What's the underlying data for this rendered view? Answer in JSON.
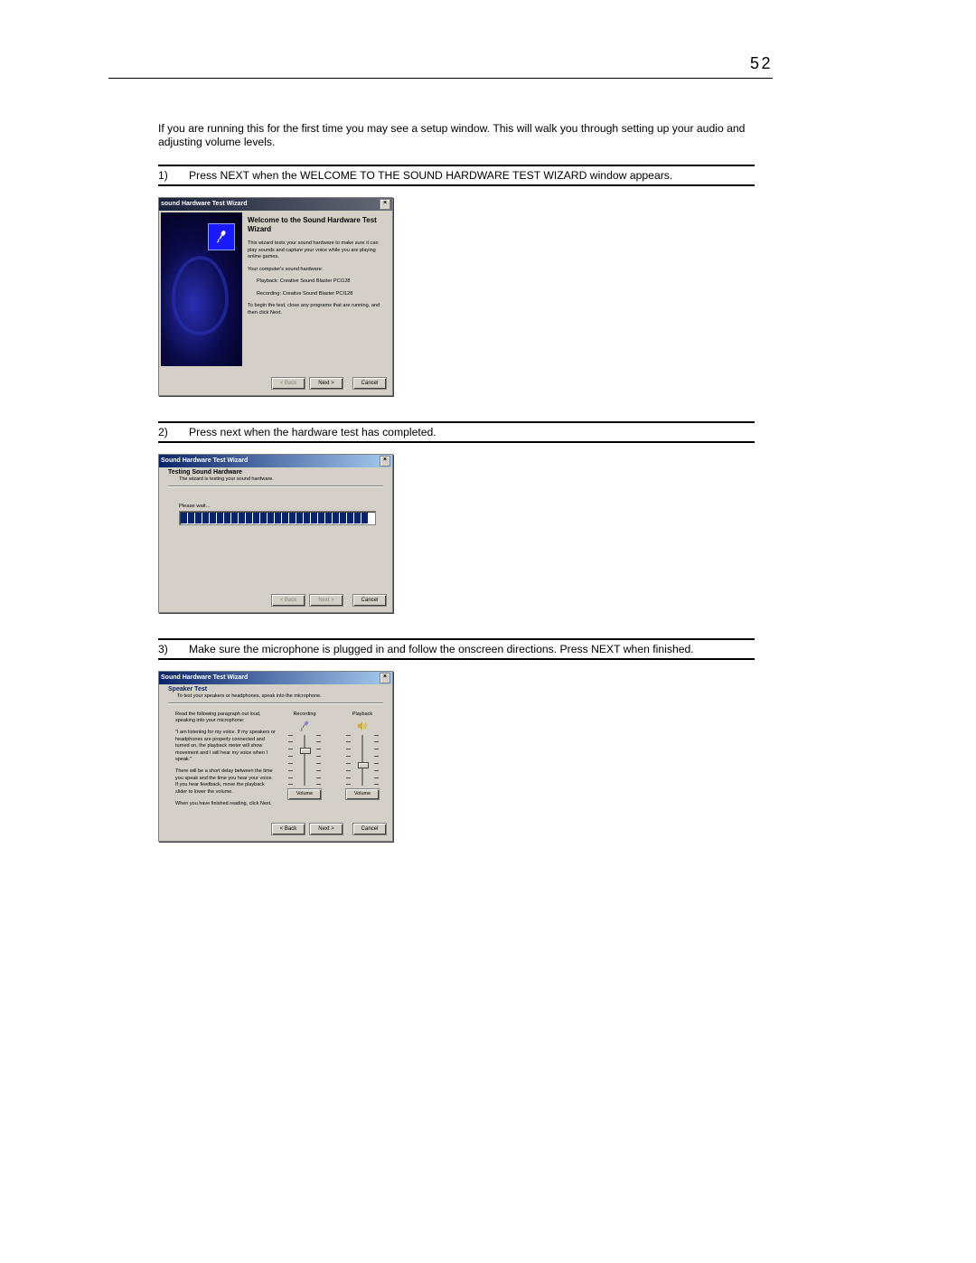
{
  "page_number": "52",
  "intro": "If you are running this for the first time you may see a setup window. This will walk you through setting up your audio and adjusting volume levels.",
  "steps": [
    {
      "num": "1)",
      "text": "Press NEXT when the WELCOME TO THE SOUND HARDWARE TEST WIZARD window appears."
    },
    {
      "num": "2)",
      "text": "Press next when the hardware test has completed."
    },
    {
      "num": "3)",
      "text": "Make sure the microphone is plugged in and follow the onscreen directions. Press NEXT when finished."
    }
  ],
  "dlg_shared": {
    "back": "< Back",
    "next": "Next >",
    "cancel": "Cancel",
    "close": "×"
  },
  "dlg1": {
    "title": "sound Hardware Test Wizard",
    "heading": "Welcome to the Sound Hardware Test Wizard",
    "p1": "This wizard tests your sound hardware to make sure it can play sounds and capture your voice while you are playing online games.",
    "p2": "Your computer's sound hardware:",
    "playback": "Playback: Creative Sound Blaster PCI128",
    "recording": "Recording: Creative Sound Blaster PCI128",
    "p3": "To begin the test, close any programs that are running, and then click Next."
  },
  "dlg2": {
    "title": "Sound Hardware Test Wizard",
    "heading": "Testing Sound Hardware",
    "sub": "The wizard is testing your sound hardware.",
    "please_wait": "Please wait...",
    "segments": 26
  },
  "dlg3": {
    "title": "Sound Hardware Test Wizard",
    "heading": "Speaker Test",
    "sub": "To test your speakers or headphones, speak into the microphone.",
    "p1": "Read the following paragraph out loud, speaking into your microphone:",
    "quote": "\"I am listening for my voice. If my speakers or headphones are properly connected and turned on, the playback meter will show movement and I will hear my voice when I speak.\"",
    "p2": "There will be a short delay between the time you speak and the time you hear your voice. If you hear feedback, move the playback slider to lower the volume.",
    "p3": "When you have finished reading, click Next.",
    "recording_label": "Recording",
    "playback_label": "Playback",
    "volume_btn": "Volume",
    "rec_thumb_pct": 25,
    "play_thumb_pct": 55
  }
}
